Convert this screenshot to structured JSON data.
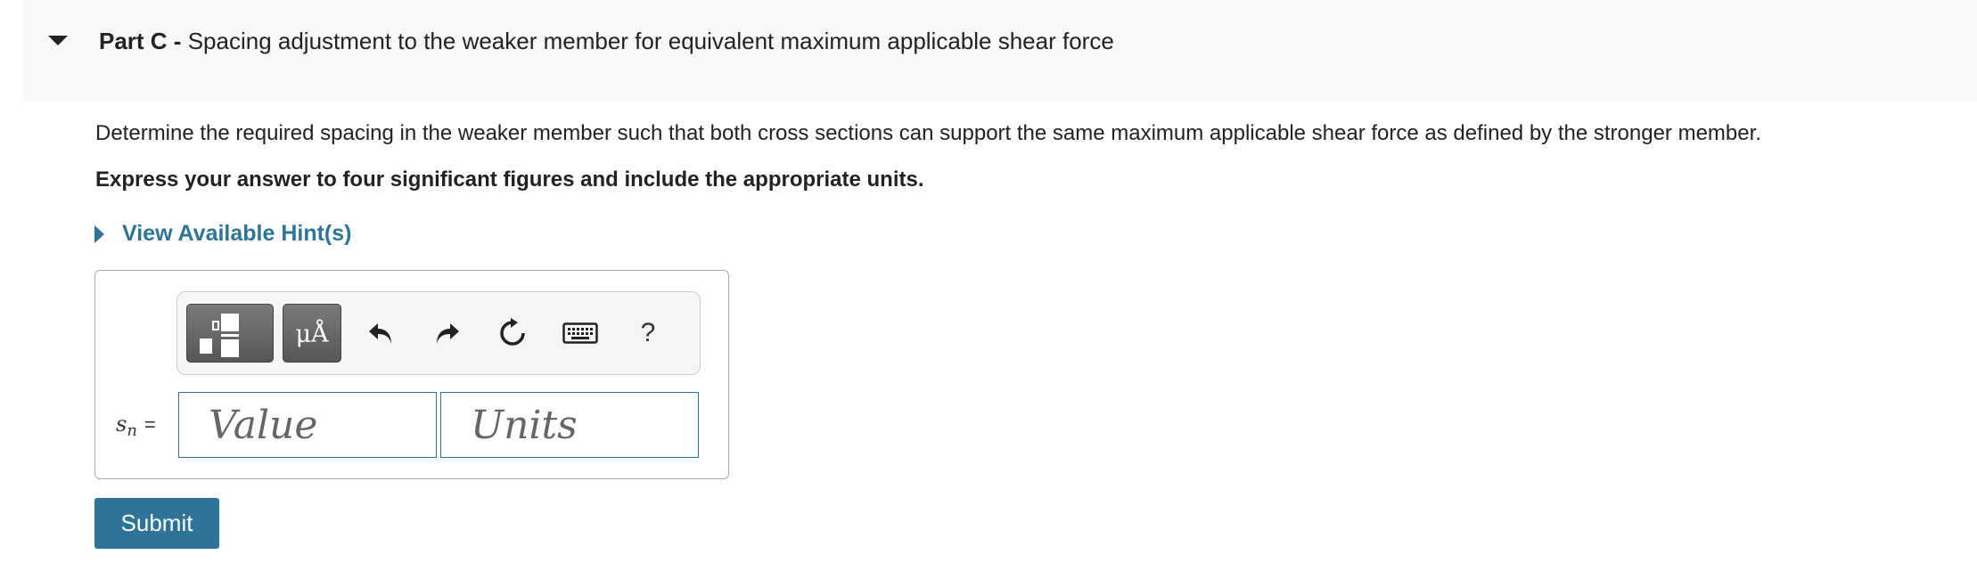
{
  "part": {
    "label": "Part C -",
    "title": "Spacing adjustment to the weaker member for equivalent maximum applicable shear force"
  },
  "question": "Determine the required spacing in the weaker member such that both cross sections can support the same maximum applicable shear force as defined by the stronger member.",
  "instruction": "Express your answer to four significant figures and include the appropriate units.",
  "hint": {
    "label": "View Available Hint(s)"
  },
  "toolbar": {
    "templates_icon": "fraction-templates-icon",
    "symbols_label": "μÅ",
    "undo_icon": "undo-icon",
    "redo_icon": "redo-icon",
    "reset_icon": "reset-icon",
    "keyboard_icon": "keyboard-icon",
    "help_label": "?"
  },
  "answer": {
    "variable": "s",
    "subscript": "n",
    "equals": "=",
    "value_placeholder": "Value",
    "value": "",
    "units_placeholder": "Units",
    "units": ""
  },
  "submit_label": "Submit",
  "colors": {
    "accent": "#2d7496",
    "header_bg": "#f7f7f7",
    "toolbar_button": "#666666"
  }
}
